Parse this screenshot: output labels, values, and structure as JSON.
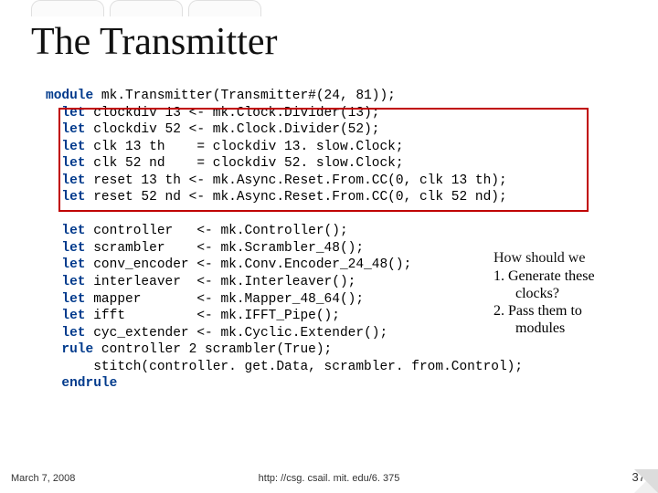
{
  "title": "The Transmitter",
  "code": {
    "l0a": "module",
    "l0b": " mk.Transmitter(Transmitter#(24, 81));",
    "l1a": "  let",
    "l1b": " clockdiv 13 <- mk.Clock.Divider(13);",
    "l2a": "  let",
    "l2b": " clockdiv 52 <- mk.Clock.Divider(52);",
    "l3a": "  let",
    "l3b": " clk 13 th    = clockdiv 13. slow.Clock;",
    "l4a": "  let",
    "l4b": " clk 52 nd    = clockdiv 52. slow.Clock;",
    "l5a": "  let",
    "l5b": " reset 13 th <- mk.Async.Reset.From.CC(0, clk 13 th);",
    "l6a": "  let",
    "l6b": " reset 52 nd <- mk.Async.Reset.From.CC(0, clk 52 nd);",
    "l7a": "  let",
    "l7b": " controller   <- mk.Controller();",
    "l8a": "  let",
    "l8b": " scrambler    <- mk.Scrambler_48();",
    "l9a": "  let",
    "l9b": " conv_encoder <- mk.Conv.Encoder_24_48();",
    "l10a": "  let",
    "l10b": " interleaver  <- mk.Interleaver();",
    "l11a": "  let",
    "l11b": " mapper       <- mk.Mapper_48_64();",
    "l12a": "  let",
    "l12b": " ifft         <- mk.IFFT_Pipe();",
    "l13a": "  let",
    "l13b": " cyc_extender <- mk.Cyclic.Extender();",
    "l14a": "  rule",
    "l14b": " controller 2 scrambler(True);",
    "l15": "      stitch(controller. get.Data, scrambler. from.Control);",
    "l16": "  endrule"
  },
  "annot": {
    "head": "How should we",
    "item1": "1. Generate these",
    "item1b": "clocks?",
    "item2": "2. Pass them to",
    "item2b": "modules"
  },
  "footer": {
    "left": "March 7, 2008",
    "center": "http: //csg. csail. mit. edu/6. 375",
    "right": "37"
  }
}
